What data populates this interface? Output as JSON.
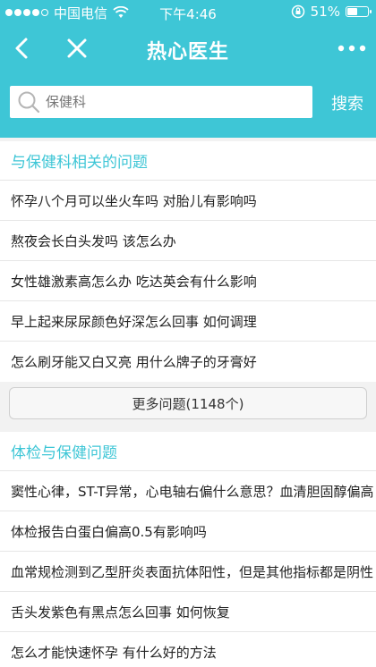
{
  "status": {
    "carrier": "中国电信",
    "time": "下午4:46",
    "battery": "51%",
    "battery_level": 0.51
  },
  "nav": {
    "title": "热心医生"
  },
  "search": {
    "placeholder": "保健科",
    "button": "搜索"
  },
  "section1": {
    "title": "与保健科相关的问题",
    "questions": [
      "怀孕八个月可以坐火车吗 对胎儿有影响吗",
      "熬夜会长白头发吗 该怎么办",
      "女性雄激素高怎么办 吃达英会有什么影响",
      "早上起来尿尿颜色好深怎么回事 如何调理",
      "怎么刷牙能又白又亮 用什么牌子的牙膏好"
    ],
    "more_button": "更多问题(1148个)"
  },
  "section2": {
    "title": "体检与保健问题",
    "questions": [
      "窦性心律，ST-T异常，心电轴右偏什么意思？血清胆固醇偏高",
      "体检报告白蛋白偏高0.5有影响吗",
      "血常规检测到乙型肝炎表面抗体阳性，但是其他指标都是阴性",
      "舌头发紫色有黑点怎么回事 如何恢复",
      "怎么才能快速怀孕 有什么好的方法"
    ]
  },
  "icons": {
    "signal": "signal-dots-icon",
    "wifi": "wifi-icon",
    "lock": "rotation-lock-icon",
    "battery": "battery-icon",
    "back": "back-arrow-icon",
    "close": "close-icon",
    "more": "more-dots-icon",
    "search": "search-icon"
  },
  "colors": {
    "accent": "#3ec6d6",
    "background": "#f2f2f2"
  }
}
